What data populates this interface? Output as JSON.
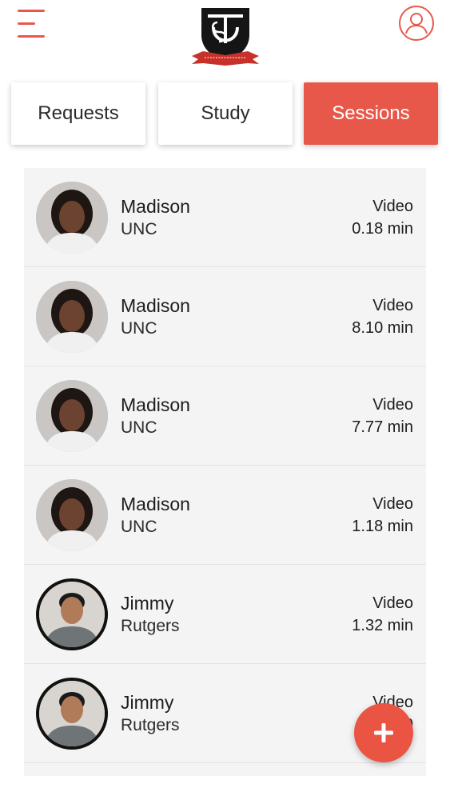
{
  "header": {
    "menu_icon": "hamburger-menu-icon",
    "logo_icon": "university-shield-logo",
    "profile_icon": "user-profile-icon",
    "accent_color": "#e8584a"
  },
  "tabs": [
    {
      "label": "Requests",
      "active": false
    },
    {
      "label": "Study",
      "active": false
    },
    {
      "label": "Sessions",
      "active": true
    }
  ],
  "sessions": [
    {
      "name": "Madison",
      "school": "UNC",
      "type": "Video",
      "duration": "0.18 min"
    },
    {
      "name": "Madison",
      "school": "UNC",
      "type": "Video",
      "duration": "8.10 min"
    },
    {
      "name": "Madison",
      "school": "UNC",
      "type": "Video",
      "duration": "7.77 min"
    },
    {
      "name": "Madison",
      "school": "UNC",
      "type": "Video",
      "duration": "1.18 min"
    },
    {
      "name": "Jimmy",
      "school": "Rutgers",
      "type": "Video",
      "duration": "1.32 min"
    },
    {
      "name": "Jimmy",
      "school": "Rutgers",
      "type": "Video",
      "duration": "0"
    }
  ],
  "fab": {
    "icon": "plus-icon"
  }
}
